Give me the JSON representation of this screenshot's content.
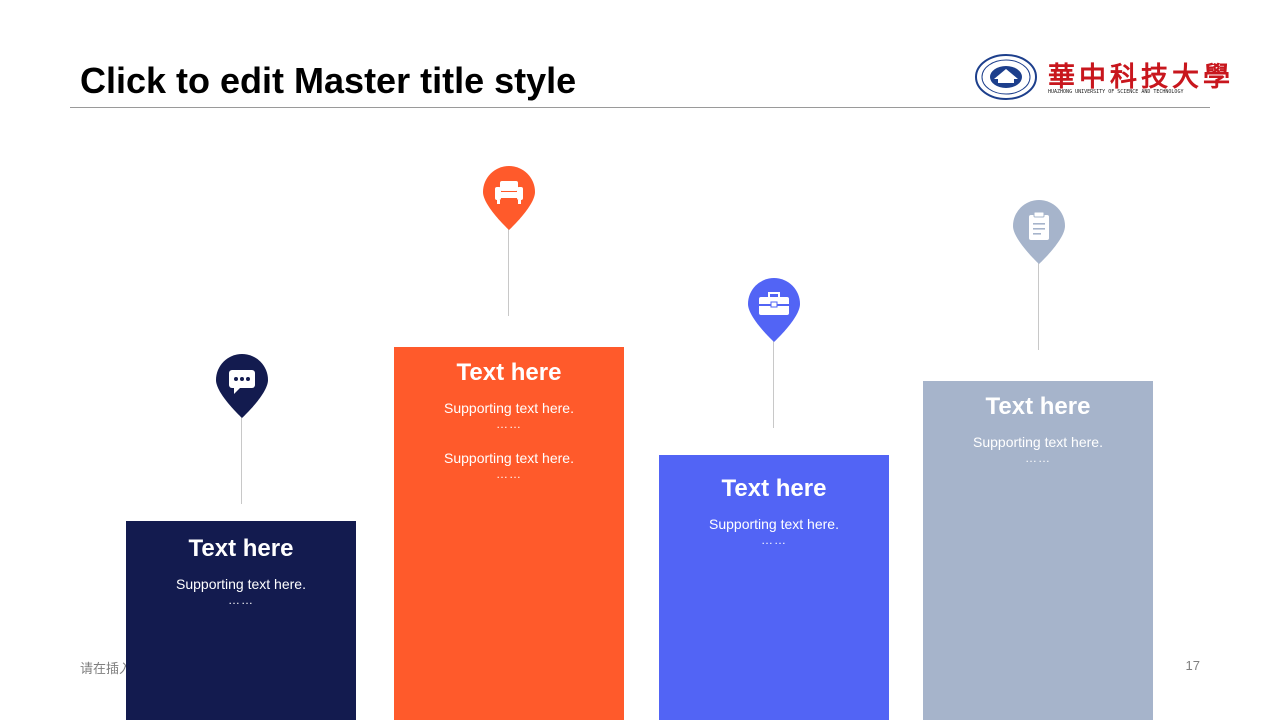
{
  "slide": {
    "title": "Click to edit Master title style",
    "footer_text": "请在插入",
    "page_number": "17"
  },
  "logo": {
    "name_cn": "華中科技大學",
    "name_en": "HUAZHONG UNIVERSITY OF SCIENCE AND TECHNOLOGY",
    "color": "#c8161d"
  },
  "columns": [
    {
      "icon": "chat-bubble-icon",
      "color": "#131b4f",
      "heading": "Text here",
      "items": [
        {
          "text": "Supporting text here.",
          "dots": "……"
        }
      ]
    },
    {
      "icon": "sofa-icon",
      "color": "#ff5a2b",
      "heading": "Text here",
      "items": [
        {
          "text": "Supporting text here.",
          "dots": "……"
        },
        {
          "text": "Supporting text here.",
          "dots": "……"
        }
      ]
    },
    {
      "icon": "toolbox-icon",
      "color": "#5264f5",
      "heading": "Text here",
      "items": [
        {
          "text": "Supporting text here.",
          "dots": "……"
        }
      ]
    },
    {
      "icon": "clipboard-icon",
      "color": "#a6b4cb",
      "heading": "Text here",
      "items": [
        {
          "text": "Supporting text here.",
          "dots": "……"
        }
      ]
    }
  ]
}
